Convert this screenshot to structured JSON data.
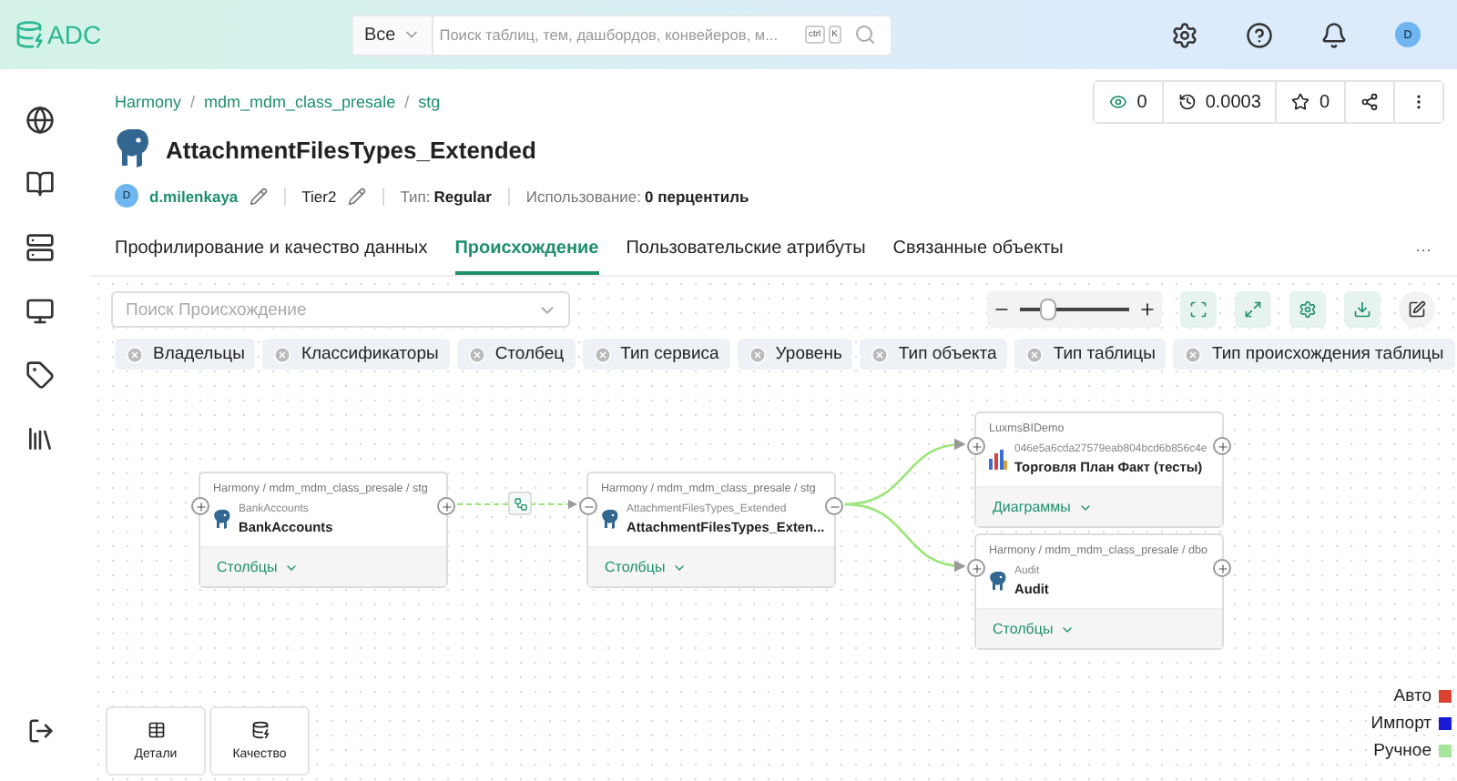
{
  "header": {
    "logo": "ADC",
    "search_scope": "Все",
    "search_placeholder": "Поиск таблиц, тем, дашбордов, конвейеров, м...",
    "shortcut_keys": [
      "ctrl",
      "K"
    ],
    "avatar": "D"
  },
  "breadcrumbs": [
    "Harmony",
    "mdm_mdm_class_presale",
    "stg"
  ],
  "breadcrumb_separator": "/",
  "stats": {
    "views": "0",
    "freshness": "0.0003",
    "stars": "0"
  },
  "title": "AttachmentFilesTypes_Extended",
  "meta": {
    "owner_avatar": "D",
    "owner": "d.milenkaya",
    "tier": "Tier2",
    "type_label": "Тип:",
    "type_value": "Regular",
    "usage_label": "Использование:",
    "usage_value": "0 перцентиль"
  },
  "tabs": [
    {
      "label": "Профилирование и качество данных",
      "selected": false
    },
    {
      "label": "Происхождение",
      "selected": true
    },
    {
      "label": "Пользовательские атрибуты",
      "selected": false
    },
    {
      "label": "Связанные объекты",
      "selected": false
    }
  ],
  "tabs_more": "···",
  "lineage_search_placeholder": "Поиск Происхождение",
  "zoom": {
    "level": 0.25
  },
  "filters": [
    "Владельцы",
    "Классификаторы",
    "Столбец",
    "Тип сервиса",
    "Уровень",
    "Тип объекта",
    "Тип таблицы",
    "Тип происхождения таблицы"
  ],
  "nodes": [
    {
      "kind": "table",
      "path": "Harmony / mdm_mdm_class_presale / stg",
      "subtitle": "BankAccounts",
      "name": "BankAccounts",
      "footer": "Столбцы",
      "upstream_expanded": false,
      "downstream_expanded": false
    },
    {
      "kind": "table",
      "path": "Harmony / mdm_mdm_class_presale / stg",
      "subtitle": "AttachmentFilesTypes_Extended",
      "name": "AttachmentFilesTypes_Exten...",
      "footer": "Столбцы",
      "upstream_expanded": true,
      "downstream_expanded": true
    },
    {
      "kind": "dashboard",
      "path": "LuxmsBIDemo",
      "subtitle": "046e5a6cda27579eab804bcd6b856c4e",
      "name": "Торговля План Факт (тесты)",
      "footer": "Диаграммы",
      "upstream_expanded": false,
      "downstream_expanded": false
    },
    {
      "kind": "table",
      "path": "Harmony / mdm_mdm_class_presale / dbo",
      "subtitle": "Audit",
      "name": "Audit",
      "footer": "Столбцы",
      "upstream_expanded": false,
      "downstream_expanded": false
    }
  ],
  "bottom_buttons": [
    {
      "kind": "details",
      "label": "Детали"
    },
    {
      "kind": "quality",
      "label": "Качество"
    }
  ],
  "legend": [
    {
      "label": "Авто",
      "color": "#d9432f"
    },
    {
      "label": "Импорт",
      "color": "#1a1ad6"
    },
    {
      "label": "Ручное",
      "color": "#a6e69a"
    }
  ]
}
